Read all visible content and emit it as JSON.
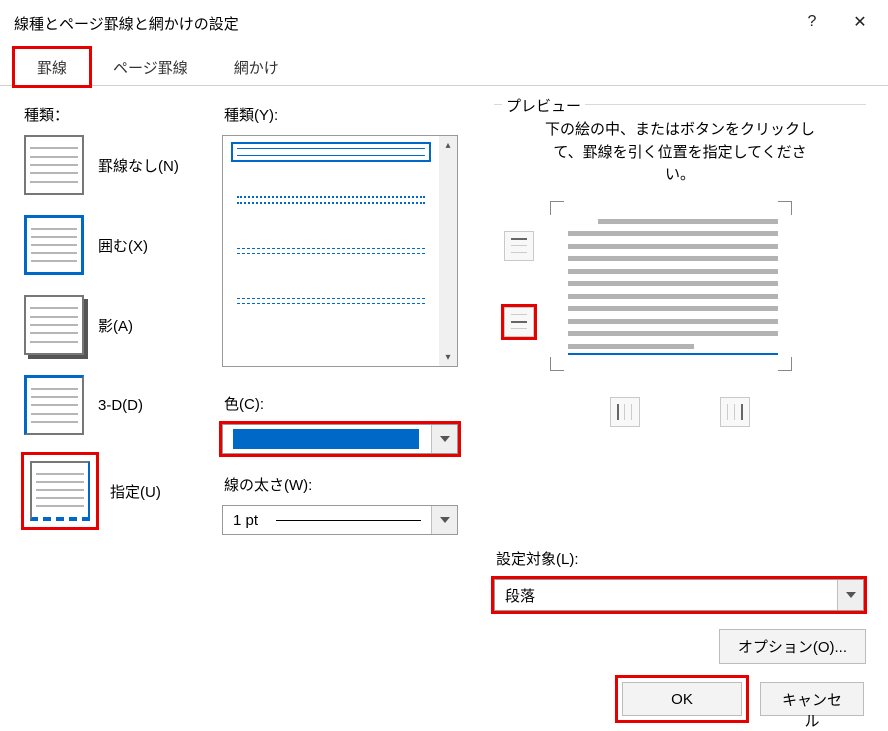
{
  "title": "線種とページ罫線と網かけの設定",
  "window": {
    "help_glyph": "?",
    "close_glyph": "✕"
  },
  "tabs": {
    "items": [
      {
        "label": "罫線",
        "active": true,
        "highlight": true
      },
      {
        "label": "ページ罫線",
        "active": false,
        "highlight": false
      },
      {
        "label": "網かけ",
        "active": false,
        "highlight": false
      }
    ]
  },
  "setting": {
    "label": "種類：",
    "options": {
      "none": "罫線なし(N)",
      "box": "囲む(X)",
      "shadow": "影(A)",
      "three_d": "3-D(D)",
      "custom": "指定(U)"
    },
    "selected": "box",
    "highlight_custom": true
  },
  "style": {
    "label": "種類(Y):",
    "scroll_up": "▴",
    "scroll_down": "▾"
  },
  "color": {
    "label": "色(C):",
    "value_hex": "#0068c7",
    "highlight": true
  },
  "width": {
    "label": "線の太さ(W):",
    "value": "1 pt"
  },
  "preview": {
    "legend": "プレビュー",
    "hint_line1": "下の絵の中、またはボタンをクリックし",
    "hint_line2": "て、罫線を引く位置を指定してくださ",
    "hint_line3": "い。",
    "highlight_middle_h": true
  },
  "apply": {
    "label": "設定対象(L):",
    "value": "段落",
    "highlight": true
  },
  "buttons": {
    "options": "オプション(O)...",
    "ok": "OK",
    "cancel": "キャンセル",
    "highlight_ok": true
  }
}
